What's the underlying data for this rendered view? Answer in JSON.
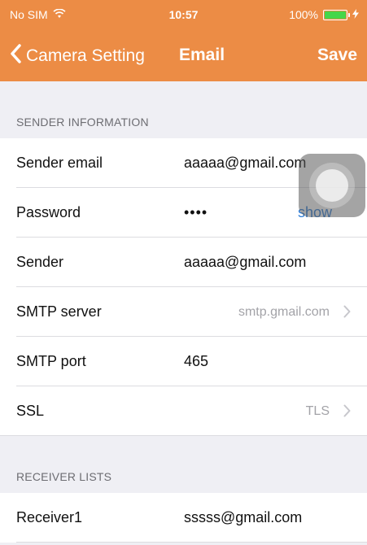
{
  "status_bar": {
    "carrier": "No SIM",
    "time": "10:57",
    "battery_percent": "100%",
    "battery_level": 1.0,
    "wifi_icon": "wifi-icon",
    "charging_icon": "bolt-icon"
  },
  "nav": {
    "back_label": "Camera Setting",
    "title": "Email",
    "save_label": "Save",
    "accent_color": "#ec8c45"
  },
  "sections": {
    "sender_header": "SENDER INFORMATION",
    "receiver_header": "RECEIVER LISTS"
  },
  "sender": {
    "email_label": "Sender email",
    "email_value": "aaaaa@gmail.com",
    "password_label": "Password",
    "password_value": "••••",
    "show_label": "show",
    "sender_label": "Sender",
    "sender_value": "aaaaa@gmail.com",
    "smtp_server_label": "SMTP server",
    "smtp_server_value": "smtp.gmail.com",
    "smtp_port_label": "SMTP port",
    "smtp_port_value": "465",
    "ssl_label": "SSL",
    "ssl_value": "TLS"
  },
  "receivers": [
    {
      "label": "Receiver1",
      "value": "sssss@gmail.com"
    }
  ]
}
